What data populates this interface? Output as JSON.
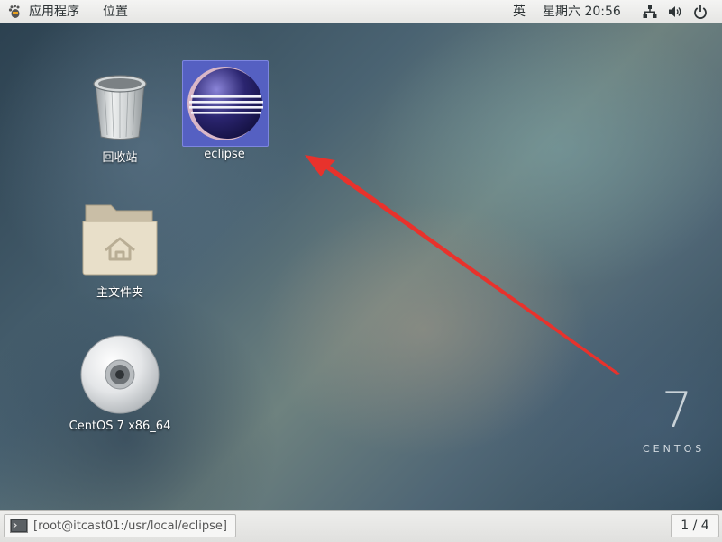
{
  "top_bar": {
    "applications_label": "应用程序",
    "places_label": "位置",
    "input_method": "英",
    "clock": "星期六 20:56",
    "icons": [
      "gnome-foot-icon",
      "network-icon",
      "volume-icon",
      "power-icon"
    ]
  },
  "desktop": {
    "icons": [
      {
        "label": "回收站",
        "icon": "trash-icon"
      },
      {
        "label": "eclipse",
        "icon": "eclipse-icon",
        "selected": true
      },
      {
        "label": "主文件夹",
        "icon": "home-folder-icon"
      },
      {
        "label": "CentOS 7 x86_64",
        "icon": "cd-drive-icon"
      }
    ],
    "watermark": {
      "version": "7",
      "name": "CENTOS"
    },
    "annotation": {
      "type": "arrow",
      "color": "#e8322c"
    }
  },
  "bottom_bar": {
    "window_title": "[root@itcast01:/usr/local/eclipse]",
    "workspace": "1 / 4"
  },
  "colors": {
    "panel": "#e9e9e7",
    "eclipse_tile": "#5560c2",
    "arrow": "#e8322c"
  }
}
